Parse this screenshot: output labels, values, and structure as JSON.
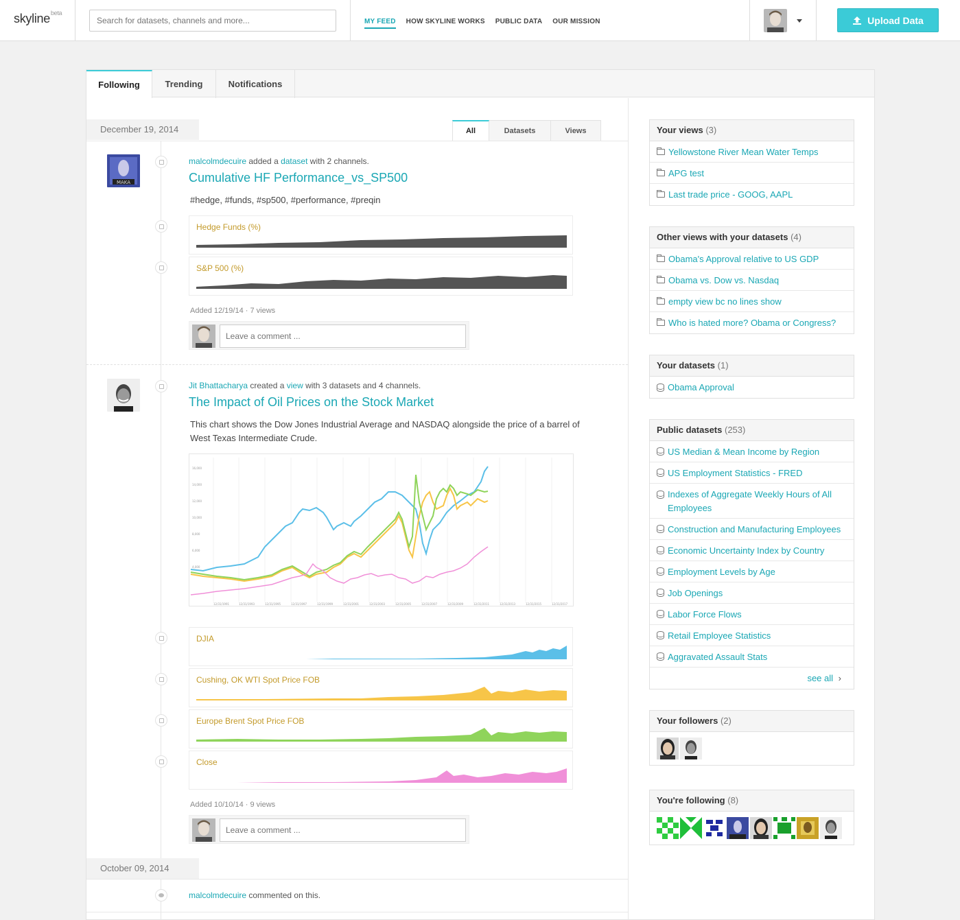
{
  "header": {
    "logo": "skyline",
    "logo_badge": "beta",
    "search_placeholder": "Search for datasets, channels and more...",
    "nav": [
      "MY FEED",
      "HOW SKYLINE WORKS",
      "PUBLIC DATA",
      "OUR MISSION"
    ],
    "upload_label": "Upload Data"
  },
  "tabs": [
    "Following",
    "Trending",
    "Notifications"
  ],
  "subtabs": [
    "All",
    "Datasets",
    "Views"
  ],
  "feed": {
    "date1": "December 19, 2014",
    "item1": {
      "user": "malcolmdecuire",
      "verb": " added a ",
      "object": "dataset",
      "rest": " with 2 channels.",
      "title": "Cumulative HF Performance_vs_SP500",
      "tags": "#hedge, #funds, #sp500, #performance, #preqin",
      "channels": [
        "Hedge Funds (%)",
        "S&P 500 (%)"
      ],
      "added": "Added 12/19/14",
      "views": "7 views",
      "comment_placeholder": "Leave a comment ..."
    },
    "item2": {
      "user": "Jit Bhattacharya",
      "verb": " created a ",
      "object": "view",
      "rest": " with 3 datasets and 4 channels.",
      "title": "The Impact of Oil Prices on the Stock Market",
      "description": "This chart shows the Dow Jones Industrial Average and NASDAQ alongside the price of a barrel of West Texas Intermediate Crude.",
      "channels": [
        "DJIA",
        "Cushing, OK WTI Spot Price FOB",
        "Europe Brent Spot Price FOB",
        "Close"
      ],
      "added": "Added 10/10/14",
      "views": "9 views",
      "comment_placeholder": "Leave a comment ..."
    },
    "date2": "October 09, 2014",
    "item3": {
      "user": "malcolmdecuire",
      "rest": " commented on this."
    }
  },
  "sidebar": {
    "your_views": {
      "title": "Your views",
      "count": "(3)",
      "items": [
        "Yellowstone River Mean Water Temps",
        "APG test",
        "Last trade price - GOOG, AAPL"
      ]
    },
    "other_views": {
      "title": "Other views with your datasets",
      "count": "(4)",
      "items": [
        "Obama's Approval relative to US GDP",
        "Obama vs. Dow vs. Nasdaq",
        "empty view bc no lines show",
        "Who is hated more? Obama or Congress?"
      ]
    },
    "your_datasets": {
      "title": "Your datasets",
      "count": "(1)",
      "items": [
        "Obama Approval"
      ]
    },
    "public_datasets": {
      "title": "Public datasets",
      "count": "(253)",
      "items": [
        "US Median & Mean Income by Region",
        "US Employment Statistics - FRED",
        "Indexes of Aggregate Weekly Hours of All Employees",
        "Construction and Manufacturing Employees",
        "Economic Uncertainty Index by Country",
        "Employment Levels by Age",
        "Job Openings",
        "Labor Force Flows",
        "Retail Employee Statistics",
        "Aggravated Assault Stats"
      ],
      "see_all": "see all"
    },
    "followers": {
      "title": "Your followers",
      "count": "(2)"
    },
    "following": {
      "title": "You're following",
      "count": "(8)"
    }
  },
  "colors": {
    "accent": "#1aa7b4",
    "upload": "#3bcbd7",
    "channel_label": "#c39a2a",
    "djia": "#5bbfe8",
    "wti": "#f7c548",
    "brent": "#8fd45b",
    "close": "#f08fd8",
    "sparkline_gray": "#555555"
  },
  "icons": [
    "upload-icon",
    "folder-icon",
    "database-icon",
    "chevron-right-icon",
    "channel-icon",
    "comment-icon",
    "caret-down-icon"
  ]
}
